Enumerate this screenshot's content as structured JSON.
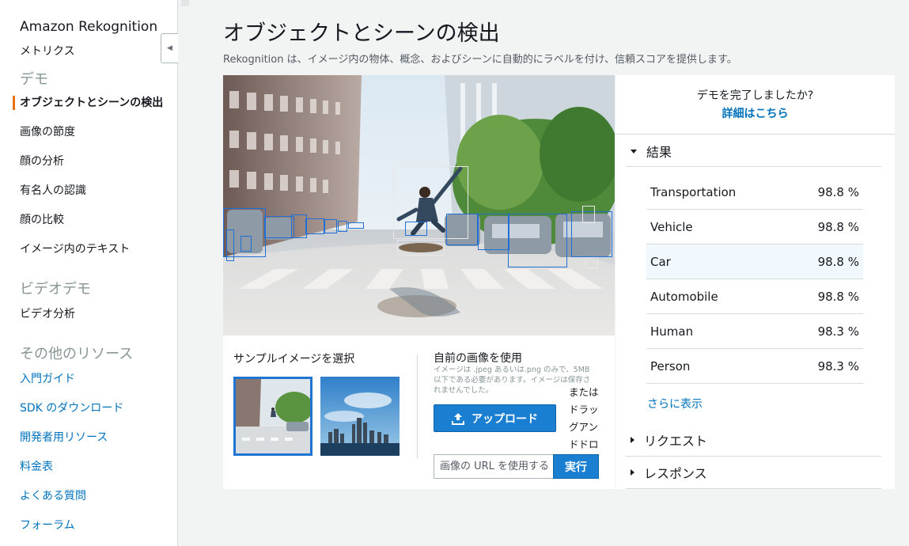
{
  "sidebar": {
    "app_title": "Amazon Rekognition",
    "metrics": "メトリクス",
    "demo_section": "デモ",
    "demo_items": [
      "オブジェクトとシーンの検出",
      "画像の節度",
      "顔の分析",
      "有名人の認識",
      "顔の比較",
      "イメージ内のテキスト"
    ],
    "video_section": "ビデオデモ",
    "video_items": [
      "ビデオ分析"
    ],
    "resources_section": "その他のリソース",
    "resource_items": [
      "入門ガイド",
      "SDK のダウンロード",
      "開発者用リソース",
      "料金表",
      "よくある質問",
      "フォーラム"
    ]
  },
  "header": {
    "title": "オブジェクトとシーンの検出",
    "description": "Rekognition は、イメージ内の物体、概念、およびシーンに自動的にラベルを付け、信頼スコアを提供します。"
  },
  "demo": {
    "sample_title": "サンプルイメージを選択",
    "own_title": "自前の画像を使用",
    "own_note": "イメージは .jpeg あるいは.png のみで、5MB 以下である必要があります。イメージは保存されませんでした。",
    "upload_label": "アップロード",
    "drag_text": "またはドラッグアンドドロ",
    "url_placeholder": "画像の URL を使用する",
    "run_label": "実行"
  },
  "results": {
    "done_question": "デモを完了しましたか?",
    "done_link": "詳細はこちら",
    "results_title": "結果",
    "rows": [
      {
        "label": "Transportation",
        "score": "98.8 %"
      },
      {
        "label": "Vehicle",
        "score": "98.8 %"
      },
      {
        "label": "Car",
        "score": "98.8 %"
      },
      {
        "label": "Automobile",
        "score": "98.8 %"
      },
      {
        "label": "Human",
        "score": "98.3 %"
      },
      {
        "label": "Person",
        "score": "98.3 %"
      }
    ],
    "highlighted_row": 2,
    "show_more": "さらに表示",
    "request_title": "リクエスト",
    "response_title": "レスポンス"
  },
  "colors": {
    "accent": "#ec7211",
    "link": "#0073bb",
    "primary_button": "#1a7fd1",
    "bbox": "#1f6fd6"
  }
}
